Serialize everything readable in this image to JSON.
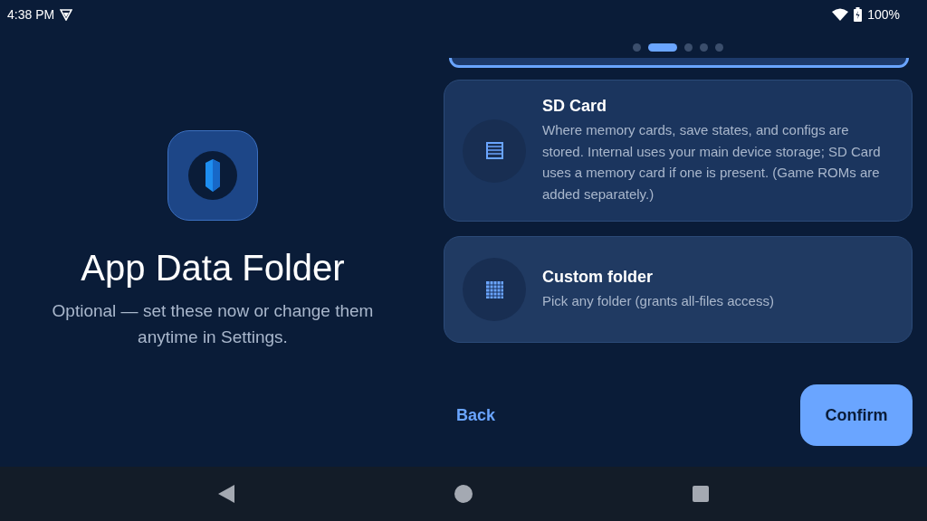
{
  "status_bar": {
    "time": "4:38 PM",
    "battery": "100%"
  },
  "intro": {
    "title": "App Data Folder",
    "subtitle": "Optional — set these now or change them anytime in Settings."
  },
  "pager": [
    {
      "selected": false
    },
    {
      "selected": true
    },
    {
      "selected": false
    },
    {
      "selected": false
    },
    {
      "selected": false
    }
  ],
  "options": [
    {
      "kind": "list",
      "title": "SD Card",
      "description": "Where memory cards, save states, and configs are stored. Internal uses your main device storage; SD Card uses a memory card if one is present. (Game ROMs are added separately.)"
    },
    {
      "kind": "grid",
      "title": "Custom folder",
      "description": "Pick any folder (grants all-files access)"
    }
  ],
  "buttons": {
    "back": "Back",
    "confirm": "Confirm"
  }
}
